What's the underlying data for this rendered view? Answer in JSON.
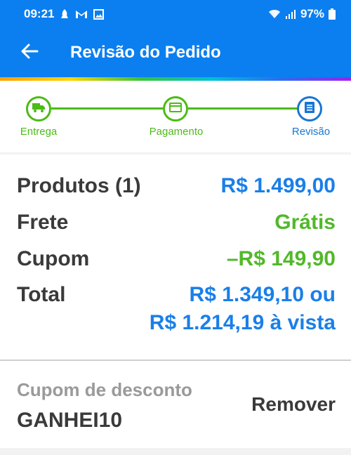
{
  "status_bar": {
    "time": "09:21",
    "battery": "97%",
    "icons_left": [
      "notification-icon",
      "gmail-icon",
      "image-icon"
    ],
    "icons_right": [
      "wifi-icon",
      "signal-icon",
      "battery-icon"
    ]
  },
  "app_bar": {
    "title": "Revisão do Pedido",
    "back_icon": "arrow-left-icon"
  },
  "stepper": {
    "steps": [
      {
        "label": "Entrega",
        "icon": "truck-icon",
        "state": "done"
      },
      {
        "label": "Pagamento",
        "icon": "card-icon",
        "state": "done"
      },
      {
        "label": "Revisão",
        "icon": "receipt-icon",
        "state": "current"
      }
    ],
    "colors": {
      "done": "#4cbb17",
      "current": "#1876d2"
    }
  },
  "summary": {
    "products": {
      "label": "Produtos (1)",
      "value": "R$ 1.499,00"
    },
    "shipping": {
      "label": "Frete",
      "value": "Grátis"
    },
    "coupon": {
      "label": "Cupom",
      "value": "–R$ 149,90"
    },
    "total": {
      "label": "Total",
      "value": "R$ 1.349,10 ou",
      "value_cash": "R$ 1.214,19 à vista"
    }
  },
  "coupon_section": {
    "label": "Cupom de desconto",
    "code": "GANHEI10",
    "remove_label": "Remover"
  },
  "colors": {
    "brand": "#0b7ff0",
    "price_blue": "#1a7fe8",
    "discount_green": "#52b82a"
  }
}
